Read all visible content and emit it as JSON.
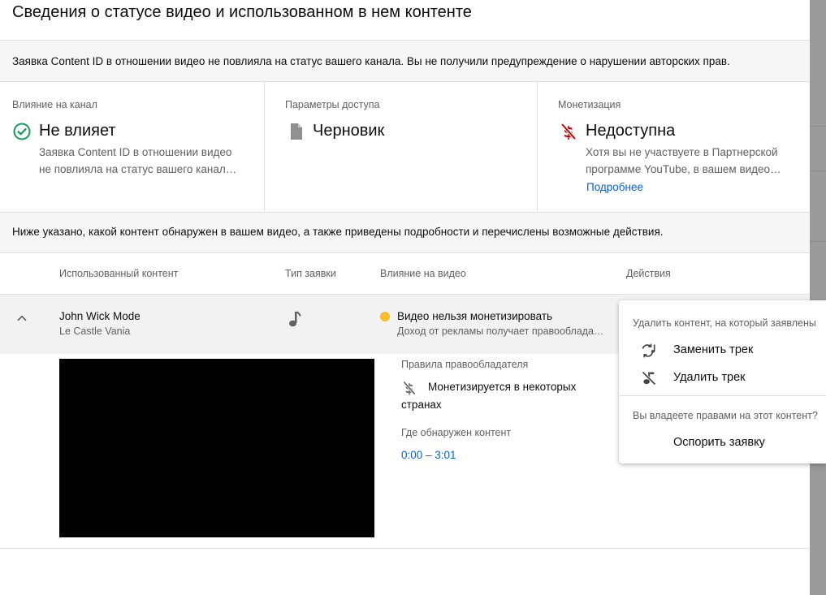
{
  "dialog": {
    "title": "Сведения о статусе видео и использованном в нем контенте",
    "notice": "Заявка Content ID в отношении видео не повлияла на статус вашего канала. Вы не получили предупреждение о нарушении авторских прав.",
    "intro": "Ниже указано, какой контент обнаружен в вашем видео, а также приведены подробности и перечислены возможные действия."
  },
  "stats": {
    "channel": {
      "label": "Влияние на канал",
      "value": "Не влияет",
      "description": "Заявка Content ID в отношении видео не повлияла на статус вашего канал…",
      "icon": "check-circle-icon",
      "color": "#0f9d58"
    },
    "visibility": {
      "label": "Параметры доступа",
      "value": "Черновик",
      "icon": "draft-file-icon",
      "color": "#909090"
    },
    "monetization": {
      "label": "Монетизация",
      "value": "Недоступна",
      "description": "Хотя вы не участвуете в Партнерской программе YouTube, в вашем видео…",
      "link": "Подробнее",
      "icon": "money-off-icon",
      "color": "#cc0000"
    }
  },
  "table": {
    "columns": [
      "Использованный контент",
      "Тип заявки",
      "Влияние на видео",
      "Действия"
    ],
    "rows": [
      {
        "title": "John Wick Mode",
        "artist": "Le Castle Vania",
        "claim_type_icon": "music-note-icon",
        "impact": "Видео нельзя монетизировать",
        "impact_detail": "Доход от рекламы получает правообладатель",
        "impact_color": "#f9bc2b"
      }
    ]
  },
  "details": {
    "policy_label": "Правила правообладателя",
    "policy": "Монетизируется в некоторых странах",
    "found_label": "Где обнаружен контент",
    "range": "0:00 – 3:01"
  },
  "menu": {
    "section1": "Удалить контент, на который заявлены",
    "replace": "Заменить трек",
    "remove": "Удалить трек",
    "section2": "Вы владеете правами на этот контент?",
    "dispute": "Оспорить заявку"
  },
  "colors": {
    "link": "#065fd4",
    "accent_yellow": "#f9bc2b"
  }
}
